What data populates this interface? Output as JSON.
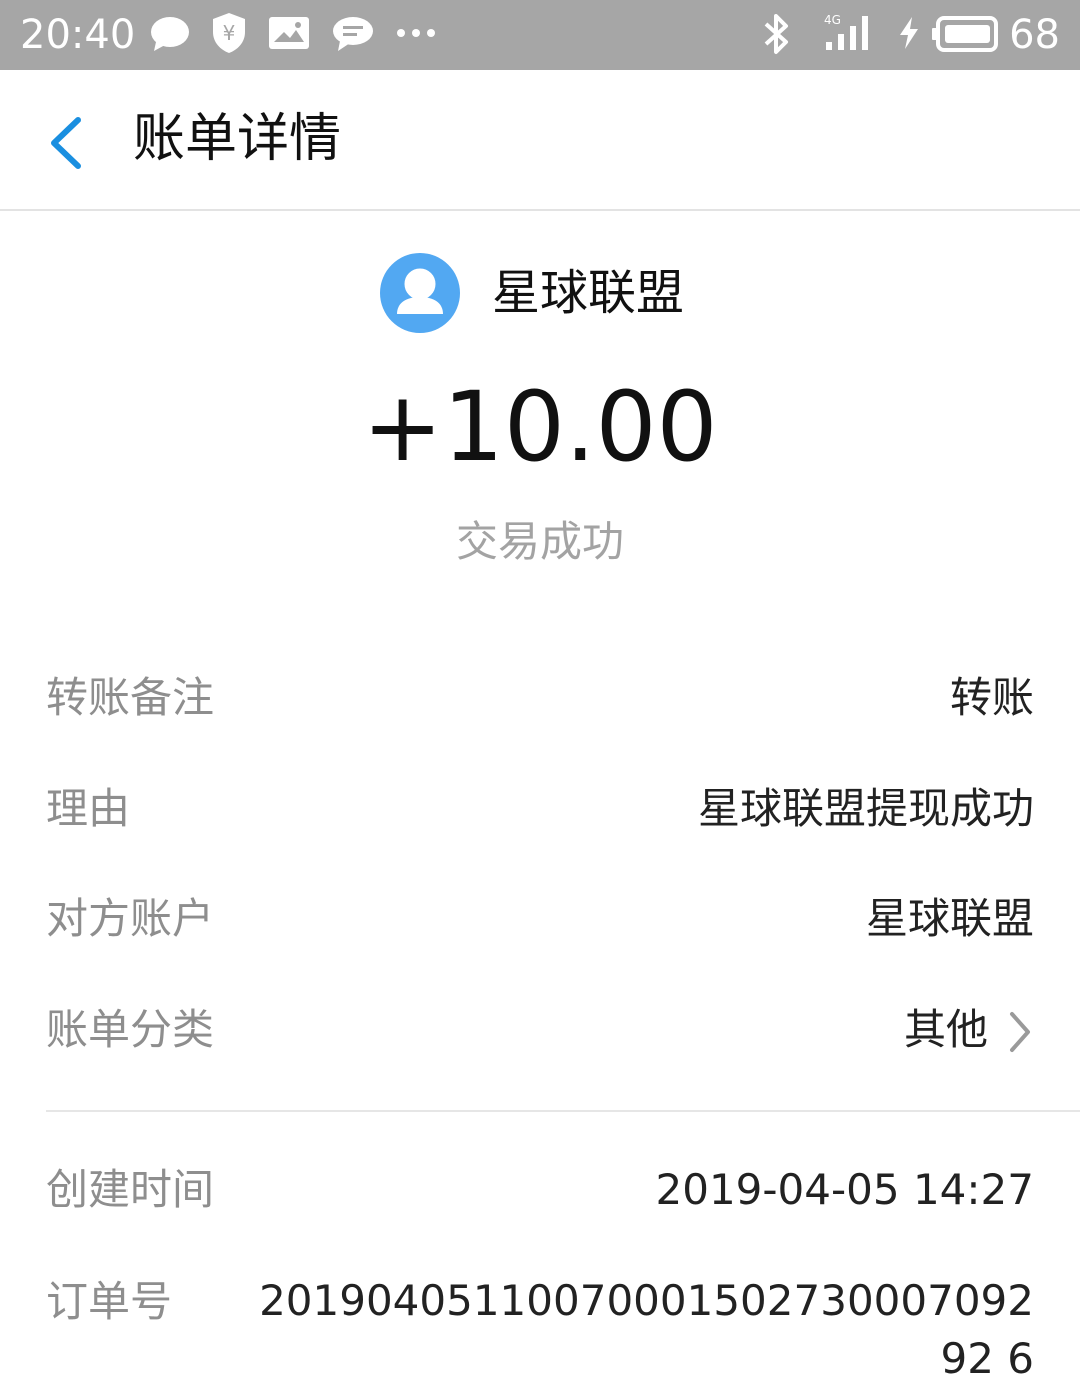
{
  "status_bar": {
    "time": "20:40",
    "battery": "68",
    "icons": [
      "chat-bubble-icon",
      "shield-yen-icon",
      "image-icon",
      "message-icon",
      "more-dots-icon",
      "bluetooth-icon",
      "signal-4g-icon",
      "charging-icon",
      "battery-icon"
    ]
  },
  "header": {
    "title": "账单详情"
  },
  "payee": {
    "name": "星球联盟"
  },
  "amount": "+10.00",
  "status": "交易成功",
  "details": [
    {
      "label": "转账备注",
      "value": "转账"
    },
    {
      "label": "理由",
      "value": "星球联盟提现成功"
    },
    {
      "label": "对方账户",
      "value": "星球联盟"
    },
    {
      "label": "账单分类",
      "value": "其他"
    }
  ],
  "meta": [
    {
      "label": "创建时间",
      "value": "2019-04-05 14:27"
    },
    {
      "label": "订单号",
      "value": "2019040511007000150273000709292 6"
    }
  ],
  "colors": {
    "accent": "#1a8fe0",
    "avatar": "#52a8f2",
    "statusbar": "#a6a6a6",
    "label": "#8e8e8e"
  }
}
